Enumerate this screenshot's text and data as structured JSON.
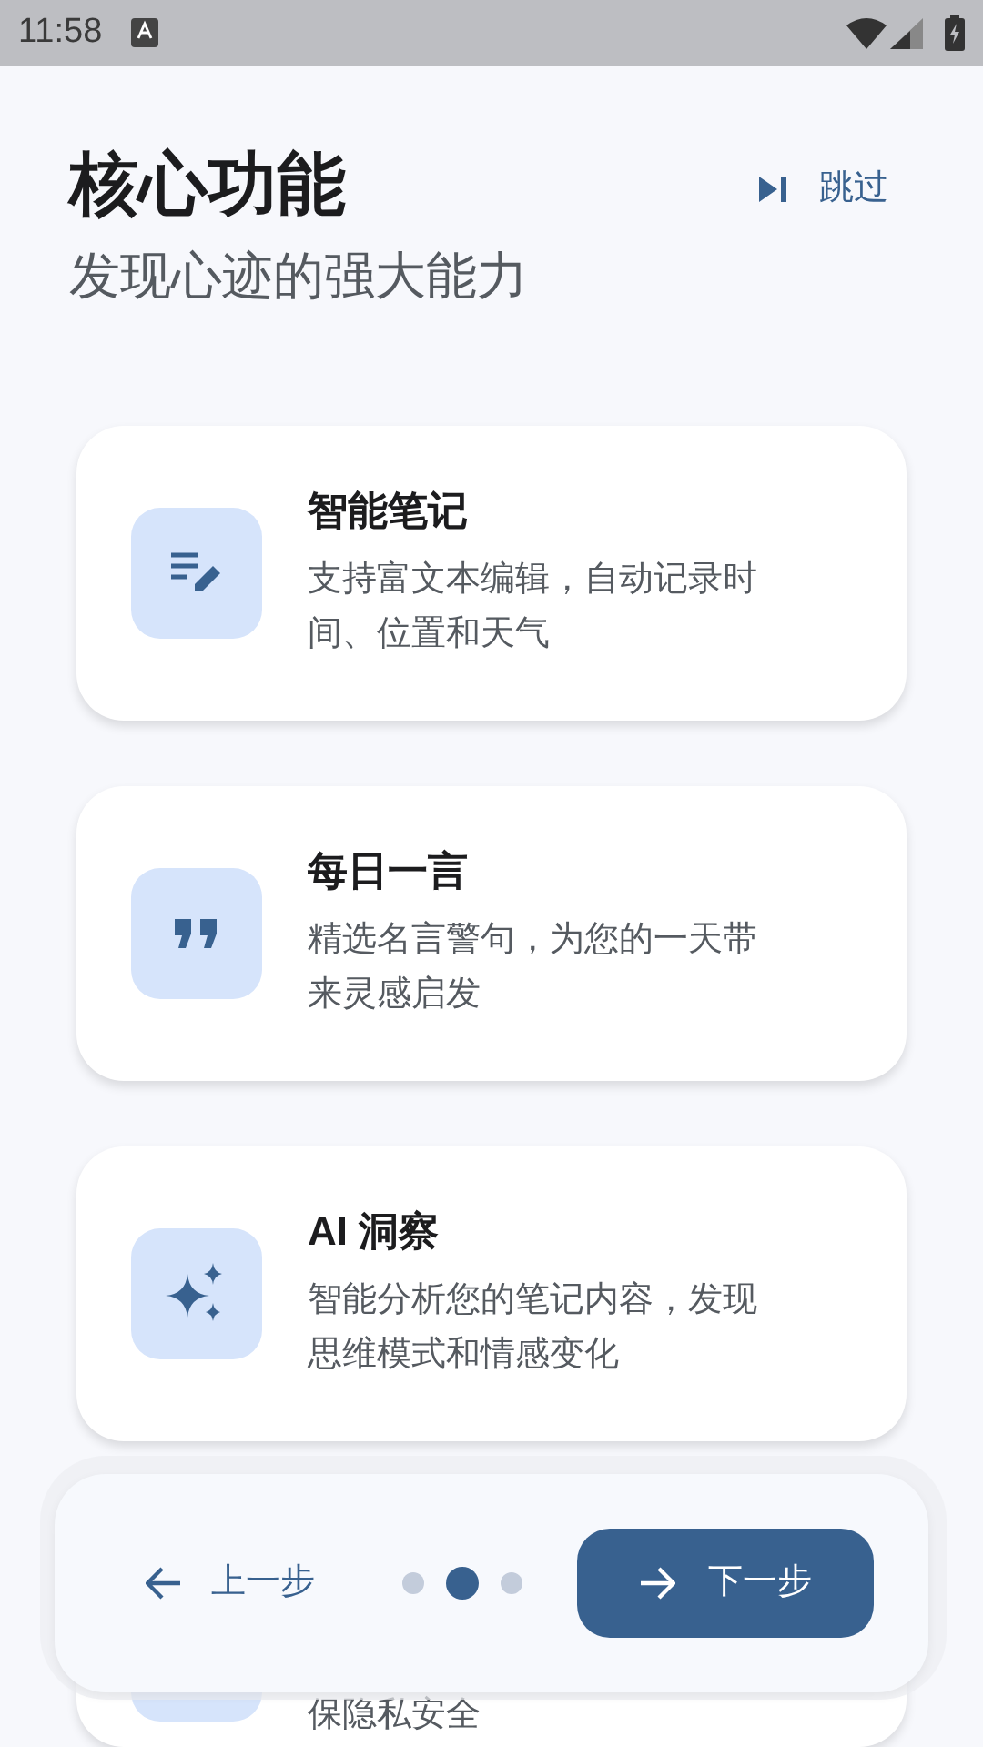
{
  "status_bar": {
    "time": "11:58"
  },
  "header": {
    "title": "核心功能",
    "subtitle": "发现心迹的强大能力",
    "skip": "跳过"
  },
  "features": [
    {
      "kind": "note",
      "title": "智能笔记",
      "description": "支持富文本编辑，自动记录时间、位置和天气"
    },
    {
      "kind": "quote",
      "title": "每日一言",
      "description": "精选名言警句，为您的一天带来灵感启发"
    },
    {
      "kind": "sparkle",
      "title": "AI 洞察",
      "description": "智能分析您的笔记内容，发现思维模式和情感变化"
    },
    {
      "kind": "partial",
      "description": "保隐私安全"
    }
  ],
  "nav": {
    "prev": "上一步",
    "next": "下一步",
    "dots": [
      {
        "selected": false
      },
      {
        "selected": true
      },
      {
        "selected": false
      }
    ]
  }
}
